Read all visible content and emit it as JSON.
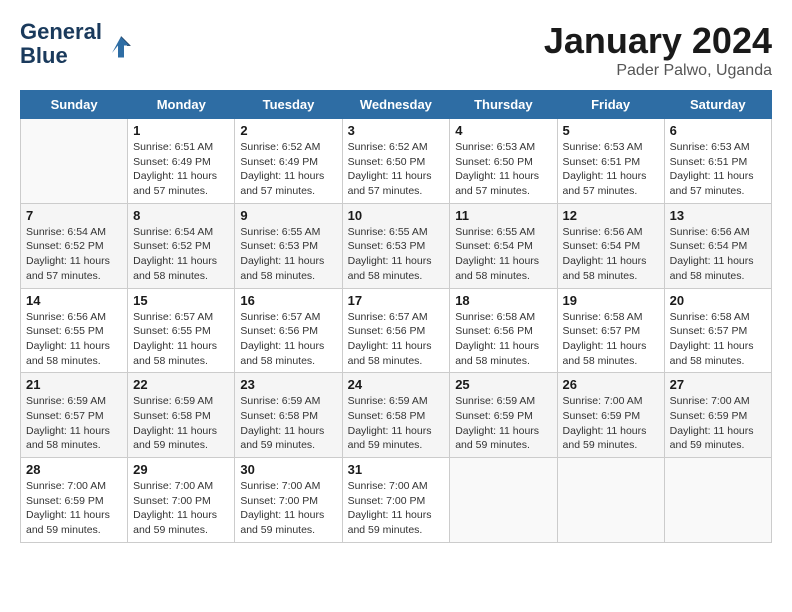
{
  "header": {
    "logo_line1": "General",
    "logo_line2": "Blue",
    "month_title": "January 2024",
    "subtitle": "Pader Palwo, Uganda"
  },
  "weekdays": [
    "Sunday",
    "Monday",
    "Tuesday",
    "Wednesday",
    "Thursday",
    "Friday",
    "Saturday"
  ],
  "weeks": [
    [
      {
        "day": "",
        "sunrise": "",
        "sunset": "",
        "daylight": "",
        "empty": true
      },
      {
        "day": "1",
        "sunrise": "Sunrise: 6:51 AM",
        "sunset": "Sunset: 6:49 PM",
        "daylight": "Daylight: 11 hours and 57 minutes.",
        "empty": false
      },
      {
        "day": "2",
        "sunrise": "Sunrise: 6:52 AM",
        "sunset": "Sunset: 6:49 PM",
        "daylight": "Daylight: 11 hours and 57 minutes.",
        "empty": false
      },
      {
        "day": "3",
        "sunrise": "Sunrise: 6:52 AM",
        "sunset": "Sunset: 6:50 PM",
        "daylight": "Daylight: 11 hours and 57 minutes.",
        "empty": false
      },
      {
        "day": "4",
        "sunrise": "Sunrise: 6:53 AM",
        "sunset": "Sunset: 6:50 PM",
        "daylight": "Daylight: 11 hours and 57 minutes.",
        "empty": false
      },
      {
        "day": "5",
        "sunrise": "Sunrise: 6:53 AM",
        "sunset": "Sunset: 6:51 PM",
        "daylight": "Daylight: 11 hours and 57 minutes.",
        "empty": false
      },
      {
        "day": "6",
        "sunrise": "Sunrise: 6:53 AM",
        "sunset": "Sunset: 6:51 PM",
        "daylight": "Daylight: 11 hours and 57 minutes.",
        "empty": false
      }
    ],
    [
      {
        "day": "7",
        "sunrise": "Sunrise: 6:54 AM",
        "sunset": "Sunset: 6:52 PM",
        "daylight": "Daylight: 11 hours and 57 minutes.",
        "empty": false
      },
      {
        "day": "8",
        "sunrise": "Sunrise: 6:54 AM",
        "sunset": "Sunset: 6:52 PM",
        "daylight": "Daylight: 11 hours and 58 minutes.",
        "empty": false
      },
      {
        "day": "9",
        "sunrise": "Sunrise: 6:55 AM",
        "sunset": "Sunset: 6:53 PM",
        "daylight": "Daylight: 11 hours and 58 minutes.",
        "empty": false
      },
      {
        "day": "10",
        "sunrise": "Sunrise: 6:55 AM",
        "sunset": "Sunset: 6:53 PM",
        "daylight": "Daylight: 11 hours and 58 minutes.",
        "empty": false
      },
      {
        "day": "11",
        "sunrise": "Sunrise: 6:55 AM",
        "sunset": "Sunset: 6:54 PM",
        "daylight": "Daylight: 11 hours and 58 minutes.",
        "empty": false
      },
      {
        "day": "12",
        "sunrise": "Sunrise: 6:56 AM",
        "sunset": "Sunset: 6:54 PM",
        "daylight": "Daylight: 11 hours and 58 minutes.",
        "empty": false
      },
      {
        "day": "13",
        "sunrise": "Sunrise: 6:56 AM",
        "sunset": "Sunset: 6:54 PM",
        "daylight": "Daylight: 11 hours and 58 minutes.",
        "empty": false
      }
    ],
    [
      {
        "day": "14",
        "sunrise": "Sunrise: 6:56 AM",
        "sunset": "Sunset: 6:55 PM",
        "daylight": "Daylight: 11 hours and 58 minutes.",
        "empty": false
      },
      {
        "day": "15",
        "sunrise": "Sunrise: 6:57 AM",
        "sunset": "Sunset: 6:55 PM",
        "daylight": "Daylight: 11 hours and 58 minutes.",
        "empty": false
      },
      {
        "day": "16",
        "sunrise": "Sunrise: 6:57 AM",
        "sunset": "Sunset: 6:56 PM",
        "daylight": "Daylight: 11 hours and 58 minutes.",
        "empty": false
      },
      {
        "day": "17",
        "sunrise": "Sunrise: 6:57 AM",
        "sunset": "Sunset: 6:56 PM",
        "daylight": "Daylight: 11 hours and 58 minutes.",
        "empty": false
      },
      {
        "day": "18",
        "sunrise": "Sunrise: 6:58 AM",
        "sunset": "Sunset: 6:56 PM",
        "daylight": "Daylight: 11 hours and 58 minutes.",
        "empty": false
      },
      {
        "day": "19",
        "sunrise": "Sunrise: 6:58 AM",
        "sunset": "Sunset: 6:57 PM",
        "daylight": "Daylight: 11 hours and 58 minutes.",
        "empty": false
      },
      {
        "day": "20",
        "sunrise": "Sunrise: 6:58 AM",
        "sunset": "Sunset: 6:57 PM",
        "daylight": "Daylight: 11 hours and 58 minutes.",
        "empty": false
      }
    ],
    [
      {
        "day": "21",
        "sunrise": "Sunrise: 6:59 AM",
        "sunset": "Sunset: 6:57 PM",
        "daylight": "Daylight: 11 hours and 58 minutes.",
        "empty": false
      },
      {
        "day": "22",
        "sunrise": "Sunrise: 6:59 AM",
        "sunset": "Sunset: 6:58 PM",
        "daylight": "Daylight: 11 hours and 59 minutes.",
        "empty": false
      },
      {
        "day": "23",
        "sunrise": "Sunrise: 6:59 AM",
        "sunset": "Sunset: 6:58 PM",
        "daylight": "Daylight: 11 hours and 59 minutes.",
        "empty": false
      },
      {
        "day": "24",
        "sunrise": "Sunrise: 6:59 AM",
        "sunset": "Sunset: 6:58 PM",
        "daylight": "Daylight: 11 hours and 59 minutes.",
        "empty": false
      },
      {
        "day": "25",
        "sunrise": "Sunrise: 6:59 AM",
        "sunset": "Sunset: 6:59 PM",
        "daylight": "Daylight: 11 hours and 59 minutes.",
        "empty": false
      },
      {
        "day": "26",
        "sunrise": "Sunrise: 7:00 AM",
        "sunset": "Sunset: 6:59 PM",
        "daylight": "Daylight: 11 hours and 59 minutes.",
        "empty": false
      },
      {
        "day": "27",
        "sunrise": "Sunrise: 7:00 AM",
        "sunset": "Sunset: 6:59 PM",
        "daylight": "Daylight: 11 hours and 59 minutes.",
        "empty": false
      }
    ],
    [
      {
        "day": "28",
        "sunrise": "Sunrise: 7:00 AM",
        "sunset": "Sunset: 6:59 PM",
        "daylight": "Daylight: 11 hours and 59 minutes.",
        "empty": false
      },
      {
        "day": "29",
        "sunrise": "Sunrise: 7:00 AM",
        "sunset": "Sunset: 7:00 PM",
        "daylight": "Daylight: 11 hours and 59 minutes.",
        "empty": false
      },
      {
        "day": "30",
        "sunrise": "Sunrise: 7:00 AM",
        "sunset": "Sunset: 7:00 PM",
        "daylight": "Daylight: 11 hours and 59 minutes.",
        "empty": false
      },
      {
        "day": "31",
        "sunrise": "Sunrise: 7:00 AM",
        "sunset": "Sunset: 7:00 PM",
        "daylight": "Daylight: 11 hours and 59 minutes.",
        "empty": false
      },
      {
        "day": "",
        "sunrise": "",
        "sunset": "",
        "daylight": "",
        "empty": true
      },
      {
        "day": "",
        "sunrise": "",
        "sunset": "",
        "daylight": "",
        "empty": true
      },
      {
        "day": "",
        "sunrise": "",
        "sunset": "",
        "daylight": "",
        "empty": true
      }
    ]
  ]
}
